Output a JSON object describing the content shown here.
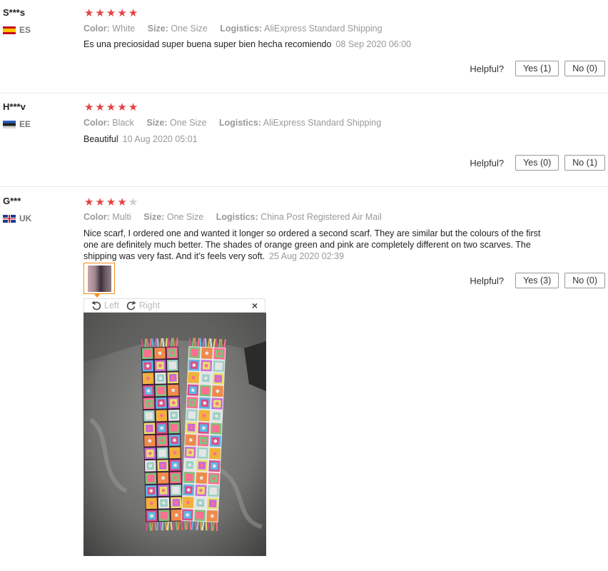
{
  "reviews": [
    {
      "user": "S***s",
      "country": "ES",
      "stars": 5,
      "color_label": "Color:",
      "color": "White",
      "size_label": "Size:",
      "size": "One Size",
      "logistics_label": "Logistics:",
      "logistics": "AliExpress Standard Shipping",
      "text": "Es una preciosidad super buena super bien hecha recomiendo",
      "date": "08 Sep 2020 06:00",
      "helpful_label": "Helpful?",
      "yes": "Yes (1)",
      "no": "No (0)"
    },
    {
      "user": "H***v",
      "country": "EE",
      "stars": 5,
      "color_label": "Color:",
      "color": "Black",
      "size_label": "Size:",
      "size": "One Size",
      "logistics_label": "Logistics:",
      "logistics": "AliExpress Standard Shipping",
      "text": "Beautiful",
      "date": "10 Aug 2020 05:01",
      "helpful_label": "Helpful?",
      "yes": "Yes (0)",
      "no": "No (1)"
    },
    {
      "user": "G***",
      "country": "UK",
      "stars": 4,
      "color_label": "Color:",
      "color": "Multi",
      "size_label": "Size:",
      "size": "One Size",
      "logistics_label": "Logistics:",
      "logistics": "China Post Registered Air Mail",
      "text": "Nice scarf, I ordered one and wanted it longer so ordered a second scarf. They are similar but the colours of the first one are definitely much better. The shades of orange green and pink are completely different on two scarves. The shipping was very fast. And it’s feels very soft.",
      "date": "25 Aug 2020 02:39",
      "helpful_label": "Helpful?",
      "yes": "Yes (3)",
      "no": "No (0)",
      "viewer": {
        "rotate_left": "Left",
        "rotate_right": "Right",
        "close": "×"
      }
    }
  ],
  "icons": {
    "star": "★",
    "rotate_left": "rotate-left-icon",
    "rotate_right": "rotate-right-icon",
    "close": "close-icon"
  },
  "colors": {
    "star_on": "#e6413f",
    "star_off": "#cccccc",
    "thumb_border": "#f0901c"
  }
}
